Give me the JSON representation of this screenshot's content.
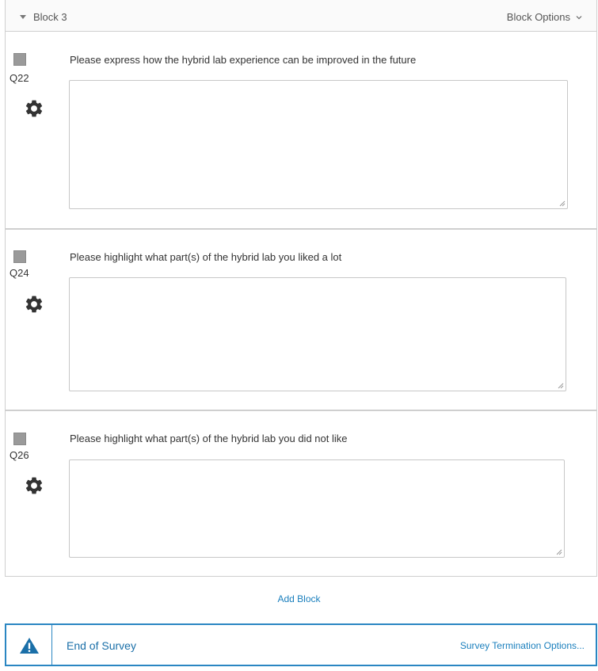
{
  "block": {
    "title": "Block 3",
    "options_label": "Block Options"
  },
  "questions": [
    {
      "number": "Q22",
      "text": "Please express how the hybrid lab experience can be improved in the future",
      "answer": ""
    },
    {
      "number": "Q24",
      "text": "Please highlight what part(s) of the hybrid lab you liked a lot",
      "answer": ""
    },
    {
      "number": "Q26",
      "text": "Please highlight what part(s) of the hybrid lab you did not like",
      "answer": ""
    }
  ],
  "add_block_label": "Add Block",
  "end_of_survey": {
    "label": "End of Survey",
    "options_label": "Survey Termination Options..."
  },
  "icons": {
    "gear": "gear-icon",
    "warning": "warning-icon",
    "caret": "caret-down-icon",
    "chevron": "chevron-down-icon"
  },
  "colors": {
    "accent": "#1a7fbd",
    "border_accent": "#2a86c2",
    "checkbox": "#9a9a9a"
  }
}
